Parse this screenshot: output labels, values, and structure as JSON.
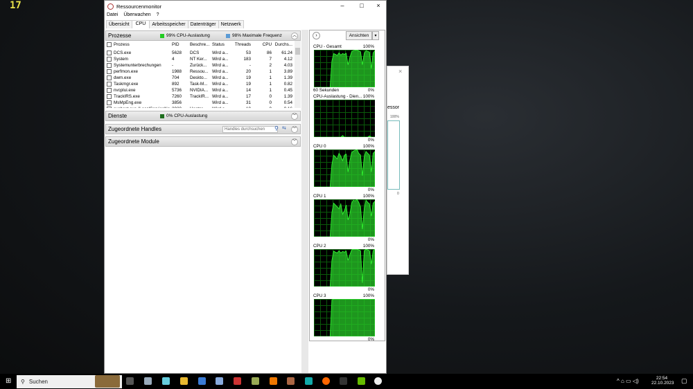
{
  "overlay_text": "17",
  "window": {
    "title": "Ressourcenmonitor",
    "menu": [
      "Datei",
      "Überwachen",
      "?"
    ],
    "tabs": [
      "Übersicht",
      "CPU",
      "Arbeitsspeicher",
      "Datenträger",
      "Netzwerk"
    ],
    "active_tab": "CPU"
  },
  "processes": {
    "title": "Prozesse",
    "cpu_usage": "99% CPU-Auslastung",
    "max_freq": "98% Maximale Frequenz",
    "usage_color": "#22cc22",
    "freq_color": "#5b9bd5",
    "columns": [
      "Prozess",
      "PID",
      "Beschre...",
      "Status",
      "Threads",
      "CPU",
      "Durchs..."
    ],
    "rows": [
      [
        "DCS.exe",
        "5628",
        "DCS",
        "Wird a...",
        "53",
        "86",
        "61.24"
      ],
      [
        "System",
        "4",
        "NT Ker...",
        "Wird a...",
        "183",
        "7",
        "4.12"
      ],
      [
        "Systemunterbrechungen",
        "-",
        "Zurück...",
        "Wird a...",
        "-",
        "2",
        "4.03"
      ],
      [
        "perfmon.exe",
        "1988",
        "Ressou...",
        "Wird a...",
        "20",
        "1",
        "3.89"
      ],
      [
        "dwm.exe",
        "704",
        "Deskto...",
        "Wird a...",
        "19",
        "1",
        "1.39"
      ],
      [
        "Taskmgr.exe",
        "892",
        "Task-M...",
        "Wird a...",
        "19",
        "1",
        "0.82"
      ],
      [
        "nvcplui.exe",
        "5736",
        "NVIDIA...",
        "Wird a...",
        "14",
        "1",
        "0.45"
      ],
      [
        "TrackIRS.exe",
        "7260",
        "TrackIR...",
        "Wird a...",
        "17",
        "0",
        "1.39"
      ],
      [
        "MsMpEng.exe",
        "3856",
        "",
        "Wird a...",
        "31",
        "0",
        "0.54"
      ],
      [
        "svchost.exe (LocalServiceNo...",
        "2020",
        "Hostpr...",
        "Wird a...",
        "10",
        "0",
        "0.16"
      ]
    ]
  },
  "services": {
    "title": "Dienste",
    "cpu_usage": "0% CPU-Auslastung",
    "usage_color": "#1e6e1e"
  },
  "handles": {
    "title": "Zugeordnete Handles",
    "search_placeholder": "Handles durchsuchen"
  },
  "modules": {
    "title": "Zugeordnete Module"
  },
  "graphs_panel": {
    "views_button": "Ansichten",
    "graphs": [
      {
        "label": "CPU - Gesamt",
        "max": "100%",
        "min": "0%",
        "footer": "60 Sekunden",
        "values": [
          0,
          0,
          0,
          0,
          0,
          0,
          0,
          0,
          0,
          0,
          70,
          90,
          88,
          85,
          92,
          86,
          90,
          88,
          91,
          60,
          80,
          95,
          98,
          99,
          100,
          97,
          95,
          60,
          90,
          98,
          96,
          94,
          50,
          92,
          98
        ]
      },
      {
        "label": "CPU-Auslastung - Dien...",
        "max": "100%",
        "min": "0%",
        "values": [
          0,
          0,
          0,
          0,
          0,
          0,
          0,
          0,
          0,
          0,
          0,
          0,
          0,
          0,
          0,
          0,
          4,
          0,
          0,
          0,
          0,
          0,
          0,
          0,
          0,
          0,
          0,
          0,
          0,
          0,
          0,
          3,
          0,
          0,
          0
        ]
      },
      {
        "label": "CPU 0",
        "max": "100%",
        "min": "0%",
        "values": [
          0,
          0,
          0,
          0,
          0,
          0,
          0,
          0,
          0,
          0,
          60,
          85,
          80,
          75,
          90,
          82,
          70,
          85,
          88,
          40,
          70,
          92,
          96,
          98,
          100,
          90,
          85,
          30,
          80,
          95,
          90,
          85,
          40,
          90,
          95
        ]
      },
      {
        "label": "CPU 1",
        "max": "100%",
        "min": "0%",
        "values": [
          0,
          0,
          0,
          0,
          0,
          0,
          0,
          0,
          0,
          0,
          65,
          90,
          85,
          80,
          75,
          88,
          60,
          70,
          85,
          45,
          60,
          90,
          98,
          96,
          100,
          92,
          80,
          20,
          75,
          98,
          92,
          88,
          55,
          90,
          95
        ]
      },
      {
        "label": "CPU 2",
        "max": "100%",
        "min": "0%",
        "values": [
          0,
          0,
          0,
          0,
          0,
          0,
          0,
          0,
          0,
          0,
          70,
          95,
          92,
          90,
          96,
          90,
          94,
          92,
          95,
          70,
          85,
          98,
          100,
          100,
          100,
          98,
          96,
          10,
          95,
          100,
          98,
          96,
          60,
          96,
          100
        ]
      },
      {
        "label": "CPU 3",
        "max": "100%",
        "min": "0%",
        "values": [
          0,
          0,
          0,
          0,
          0,
          0,
          0,
          0,
          0,
          0,
          98,
          100,
          100,
          100,
          100,
          100,
          100,
          100,
          100,
          100,
          100,
          100,
          100,
          100,
          100,
          100,
          100,
          100,
          100,
          100,
          100,
          100,
          100,
          100,
          100
        ]
      }
    ]
  },
  "background_window": {
    "fragment": "essor",
    "max": "100%",
    "min": "0"
  },
  "taskbar": {
    "search": "Suchen",
    "time": "22:54",
    "date": "22.10.2023"
  }
}
